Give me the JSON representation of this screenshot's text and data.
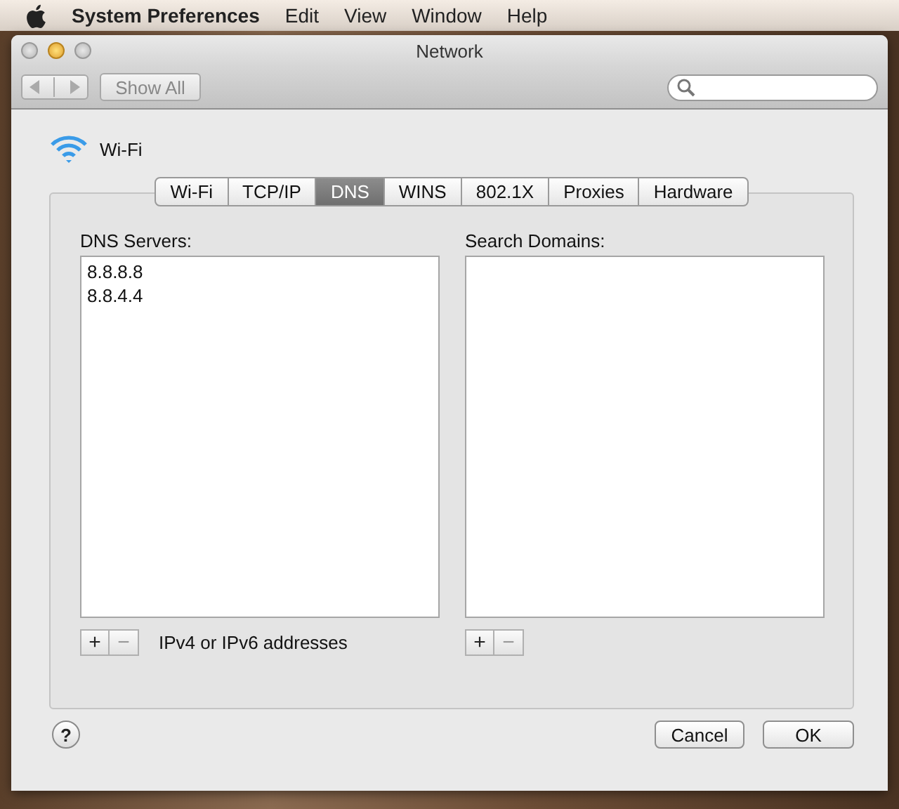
{
  "menu_bar": {
    "app": "System Preferences",
    "items": [
      "Edit",
      "View",
      "Window",
      "Help"
    ]
  },
  "window": {
    "title": "Network",
    "show_all": "Show All"
  },
  "service": {
    "name": "Wi-Fi"
  },
  "tabs": [
    {
      "label": "Wi-Fi",
      "selected": false
    },
    {
      "label": "TCP/IP",
      "selected": false
    },
    {
      "label": "DNS",
      "selected": true
    },
    {
      "label": "WINS",
      "selected": false
    },
    {
      "label": "802.1X",
      "selected": false
    },
    {
      "label": "Proxies",
      "selected": false
    },
    {
      "label": "Hardware",
      "selected": false
    }
  ],
  "dns_servers": {
    "label": "DNS Servers:",
    "entries": [
      "8.8.8.8",
      "8.8.4.4"
    ],
    "add": "+",
    "remove": "−",
    "hint": "IPv4 or IPv6 addresses"
  },
  "search_domains": {
    "label": "Search Domains:",
    "add": "+",
    "remove": "−"
  },
  "help": "?",
  "buttons": [
    "Cancel",
    "OK"
  ]
}
